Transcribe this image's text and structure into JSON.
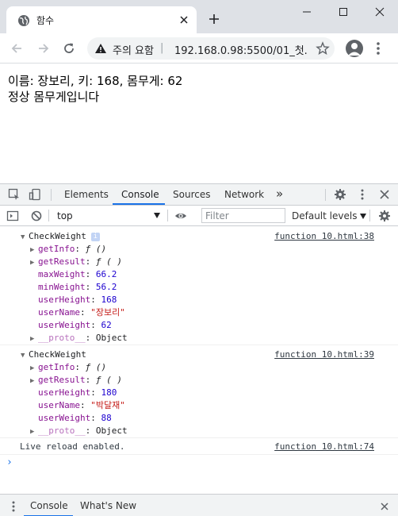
{
  "browser": {
    "tab_title": "함수",
    "security_warning": "주의 요함",
    "separator": "|",
    "url": "192.168.0.98:5500/01_첫..."
  },
  "page": {
    "line1": "이름: 장보리, 키: 168, 몸무게: 62",
    "line2": "정상 몸무게입니다"
  },
  "devtools": {
    "tabs": [
      "Elements",
      "Console",
      "Sources",
      "Network"
    ],
    "more_tabs": "»",
    "active_tab": "Console",
    "context": "top",
    "filter_placeholder": "Filter",
    "levels_label": "Default levels",
    "console": {
      "messages": [
        {
          "object": "CheckWeight",
          "source": "function 10.html:38",
          "props": [
            {
              "key": "getInfo",
              "sep": ": ",
              "value": "ƒ ()",
              "kind": "fn",
              "expandable": true
            },
            {
              "key": "getResult",
              "sep": ": ",
              "value": "ƒ ( )",
              "kind": "fn",
              "expandable": true
            },
            {
              "key": "maxWeight",
              "sep": ": ",
              "value": "66.2",
              "kind": "num",
              "expandable": false
            },
            {
              "key": "minWeight",
              "sep": ": ",
              "value": "56.2",
              "kind": "num",
              "expandable": false
            },
            {
              "key": "userHeight",
              "sep": ": ",
              "value": "168",
              "kind": "num",
              "expandable": false
            },
            {
              "key": "userName",
              "sep": ": ",
              "value": "\"장보리\"",
              "kind": "str",
              "expandable": false
            },
            {
              "key": "userWeight",
              "sep": ": ",
              "value": "62",
              "kind": "num",
              "expandable": false
            },
            {
              "key": "__proto__",
              "sep": ": ",
              "value": "Object",
              "kind": "obj",
              "expandable": true
            }
          ]
        },
        {
          "object": "CheckWeight",
          "source": "function 10.html:39",
          "props": [
            {
              "key": "getInfo",
              "sep": ": ",
              "value": "ƒ ()",
              "kind": "fn",
              "expandable": true
            },
            {
              "key": "getResult",
              "sep": ": ",
              "value": "ƒ ( )",
              "kind": "fn",
              "expandable": true
            },
            {
              "key": "userHeight",
              "sep": ": ",
              "value": "180",
              "kind": "num",
              "expandable": false
            },
            {
              "key": "userName",
              "sep": ": ",
              "value": "\"박달재\"",
              "kind": "str",
              "expandable": false
            },
            {
              "key": "userWeight",
              "sep": ": ",
              "value": "88",
              "kind": "num",
              "expandable": false
            },
            {
              "key": "__proto__",
              "sep": ": ",
              "value": "Object",
              "kind": "obj",
              "expandable": true
            }
          ]
        }
      ],
      "log": {
        "text": "Live reload enabled.",
        "source": "function 10.html:74"
      },
      "prompt": "›"
    },
    "drawer_tabs": [
      "Console",
      "What's New"
    ]
  },
  "colors": {
    "accent": "#1a73e8",
    "key": "#881391",
    "number": "#1c00cf",
    "string": "#c41a16"
  }
}
